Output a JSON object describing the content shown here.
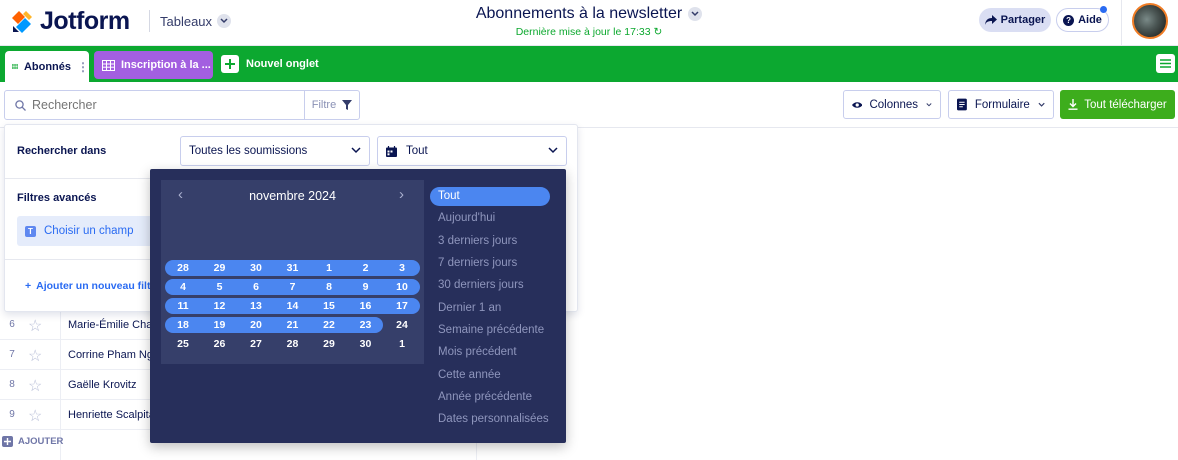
{
  "header": {
    "brand": "Jotform",
    "workspace_label": "Tableaux",
    "title": "Abonnements à la newsletter",
    "last_updated": "Dernière mise à jour le 17:33",
    "share_label": "Partager",
    "help_label": "Aide",
    "icons": [
      "jotform-logo-icon",
      "chevron-down-icon",
      "refresh-icon",
      "share-icon",
      "help-icon",
      "avatar"
    ]
  },
  "tabs": {
    "active": "Abonnés",
    "second": "Inscription à la ...",
    "new_tab": "Nouvel onglet"
  },
  "toolbar": {
    "search_placeholder": "Rechercher",
    "filter_label": "Filtre",
    "columns_label": "Colonnes",
    "form_label": "Formulaire",
    "download_label": "Tout télécharger"
  },
  "filter_panel": {
    "search_in_label": "Rechercher dans",
    "submissions_select": "Toutes les soumissions",
    "date_select": "Tout",
    "advanced_label": "Filtres avancés",
    "choose_field": "Choisir un champ",
    "add_filter": "Ajouter un nouveau filtre"
  },
  "table": {
    "rows": [
      {
        "num": "6",
        "name": "Marie-Émilie Cha"
      },
      {
        "num": "7",
        "name": "Corrine Pham Ng"
      },
      {
        "num": "8",
        "name": "Gaëlle Krovitz"
      },
      {
        "num": "9",
        "name": "Henriette Scalpita"
      }
    ],
    "add_label": "AJOUTER"
  },
  "datepicker": {
    "month_label": "novembre 2024",
    "prev": "‹",
    "next": "›",
    "weeks": [
      [
        "28",
        "29",
        "30",
        "31",
        "1",
        "2",
        "3"
      ],
      [
        "4",
        "5",
        "6",
        "7",
        "8",
        "9",
        "10"
      ],
      [
        "11",
        "12",
        "13",
        "14",
        "15",
        "16",
        "17"
      ],
      [
        "18",
        "19",
        "20",
        "21",
        "22",
        "23",
        "24"
      ],
      [
        "25",
        "26",
        "27",
        "28",
        "29",
        "30",
        "1"
      ]
    ],
    "highlighted_through": "23",
    "presets": [
      "Tout",
      "Aujourd'hui",
      "3 derniers jours",
      "7 derniers jours",
      "30 derniers jours",
      "Dernier 1 an",
      "Semaine précédente",
      "Mois précédent",
      "Cette année",
      "Année précédente",
      "Dates personnalisées"
    ],
    "active_preset": "Tout"
  },
  "colors": {
    "brand_green": "#0ca830",
    "tab_purple": "#a35fe0",
    "download_green": "#3dad1c",
    "accent_blue": "#4b86f0",
    "picker_bg": "#272f5b"
  }
}
